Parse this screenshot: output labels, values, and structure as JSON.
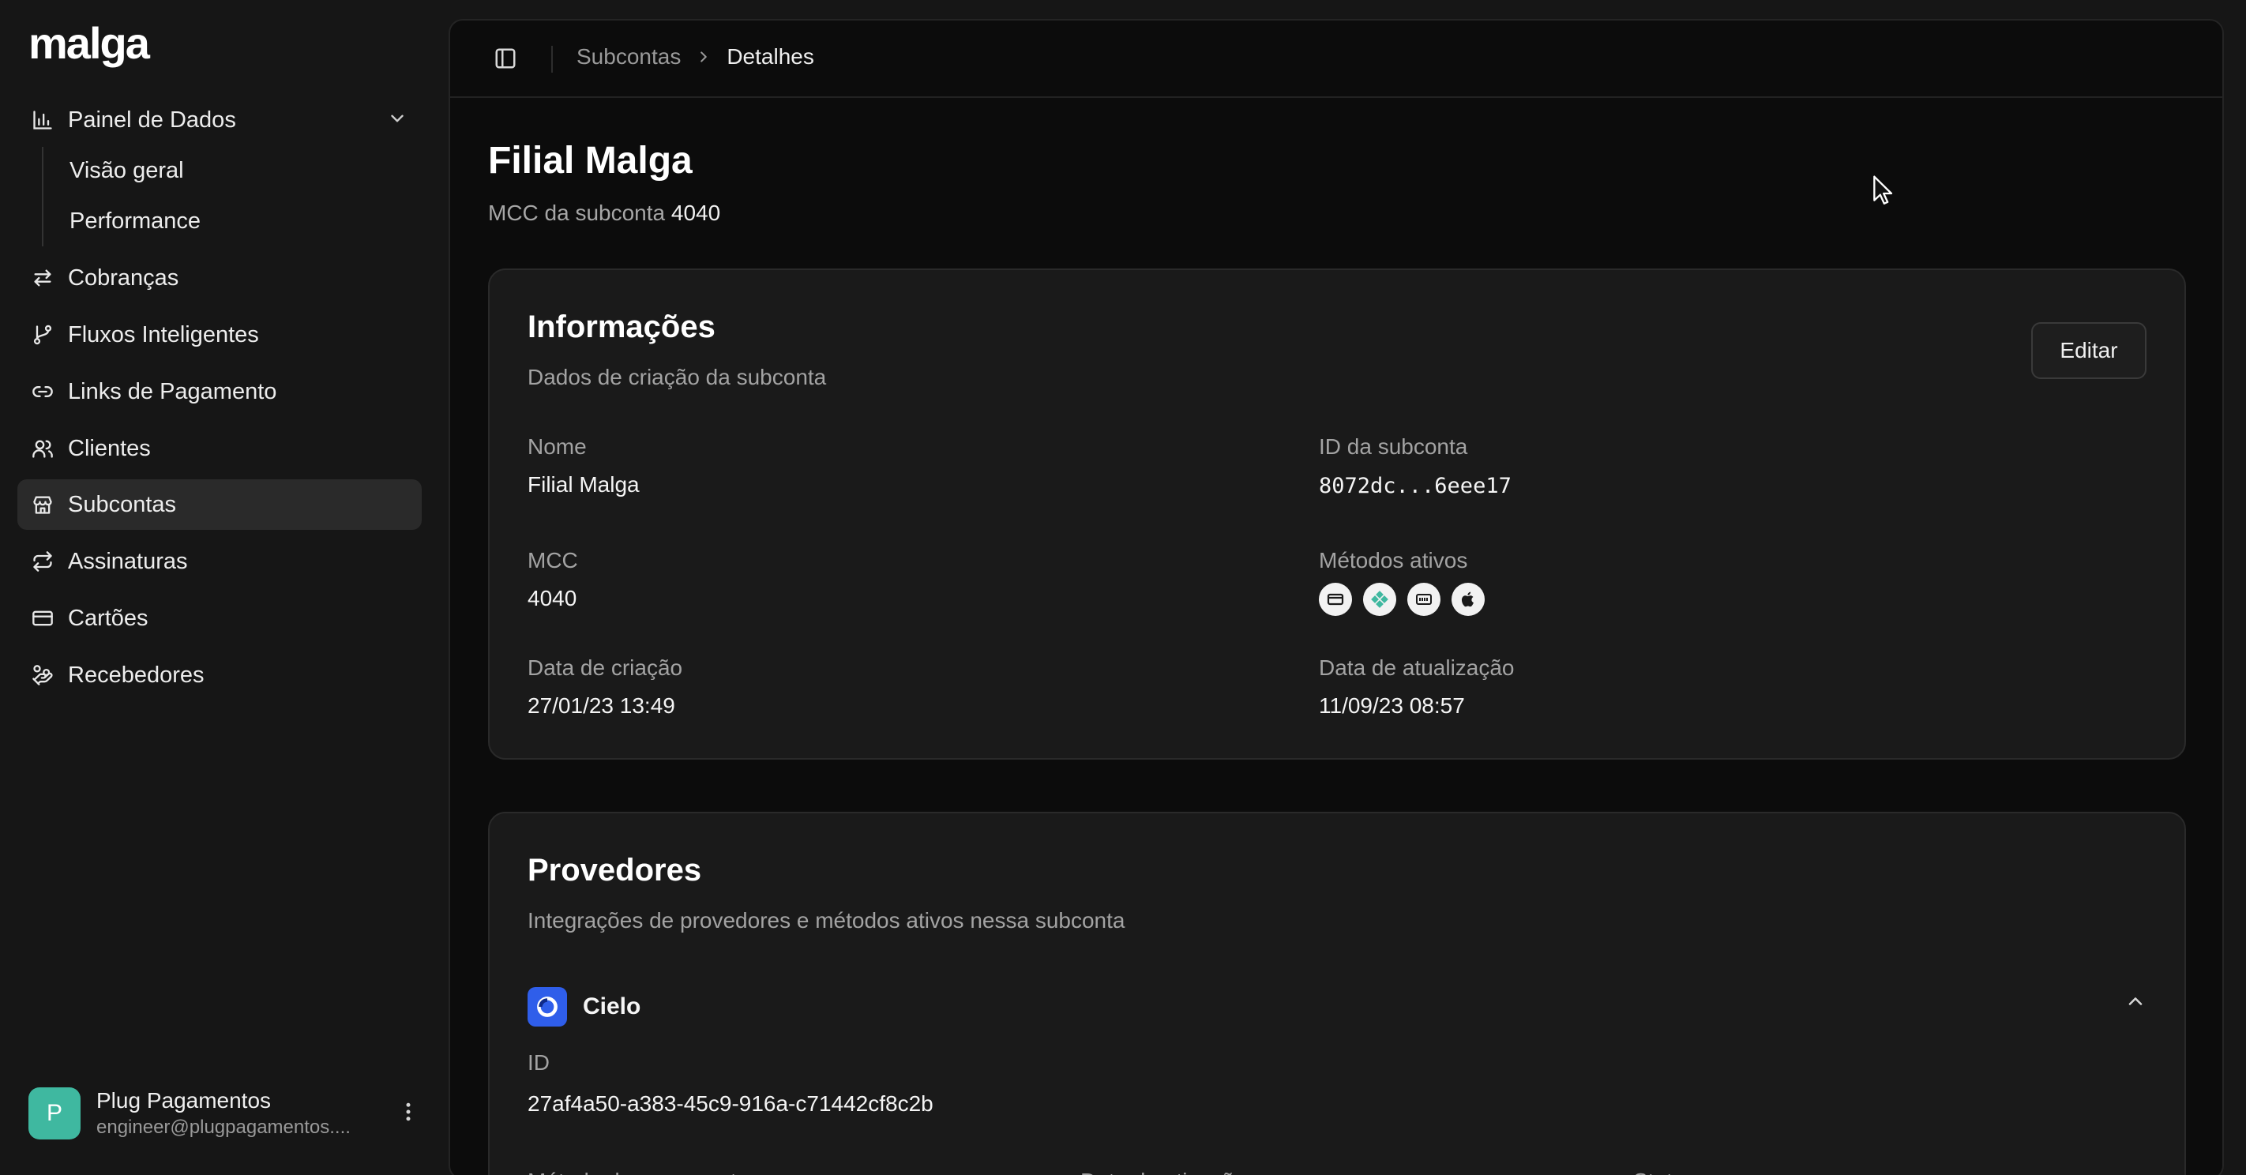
{
  "app": {
    "logo": "malga"
  },
  "sidebar": {
    "items": [
      {
        "label": "Painel de Dados",
        "icon": "bar-chart-icon"
      },
      {
        "label": "Cobranças",
        "icon": "arrows-exchange-icon"
      },
      {
        "label": "Fluxos Inteligentes",
        "icon": "git-branch-icon"
      },
      {
        "label": "Links de Pagamento",
        "icon": "link-icon"
      },
      {
        "label": "Clientes",
        "icon": "users-icon"
      },
      {
        "label": "Subcontas",
        "icon": "store-icon",
        "active": true
      },
      {
        "label": "Assinaturas",
        "icon": "repeat-icon"
      },
      {
        "label": "Cartões",
        "icon": "credit-card-icon"
      },
      {
        "label": "Recebedores",
        "icon": "hand-coins-icon"
      }
    ],
    "subitems": [
      {
        "label": "Visão geral"
      },
      {
        "label": "Performance"
      }
    ],
    "user": {
      "initial": "P",
      "name": "Plug Pagamentos",
      "email": "engineer@plugpagamentos...."
    }
  },
  "breadcrumb": {
    "parent": "Subcontas",
    "current": "Detalhes"
  },
  "page": {
    "title": "Filial Malga",
    "subtitle_label": "MCC da subconta",
    "subtitle_value": "4040"
  },
  "info_card": {
    "title": "Informações",
    "description": "Dados de criação da subconta",
    "edit_label": "Editar",
    "fields": {
      "name_label": "Nome",
      "name_value": "Filial Malga",
      "id_label": "ID da subconta",
      "id_value": "8072dc...6eee17",
      "mcc_label": "MCC",
      "mcc_value": "4040",
      "methods_label": "Métodos ativos",
      "created_label": "Data de criação",
      "created_value": "27/01/23 13:49",
      "updated_label": "Data de atualização",
      "updated_value": "11/09/23 08:57"
    },
    "method_icons": [
      "credit-card-icon",
      "pix-icon",
      "boleto-icon",
      "apple-pay-icon"
    ]
  },
  "providers_card": {
    "title": "Provedores",
    "description": "Integrações de provedores e métodos ativos nessa subconta",
    "provider": {
      "name": "Cielo",
      "id_label": "ID",
      "id_value": "27af4a50-a383-45c9-916a-c71442cf8c2b"
    },
    "columns": [
      "Método de pagamento",
      "Data de ativação",
      "Status"
    ]
  },
  "colors": {
    "accent": "#3fb8a0",
    "cielo": "#2f5eea",
    "background": "#161616",
    "main_background": "#0c0c0c"
  }
}
